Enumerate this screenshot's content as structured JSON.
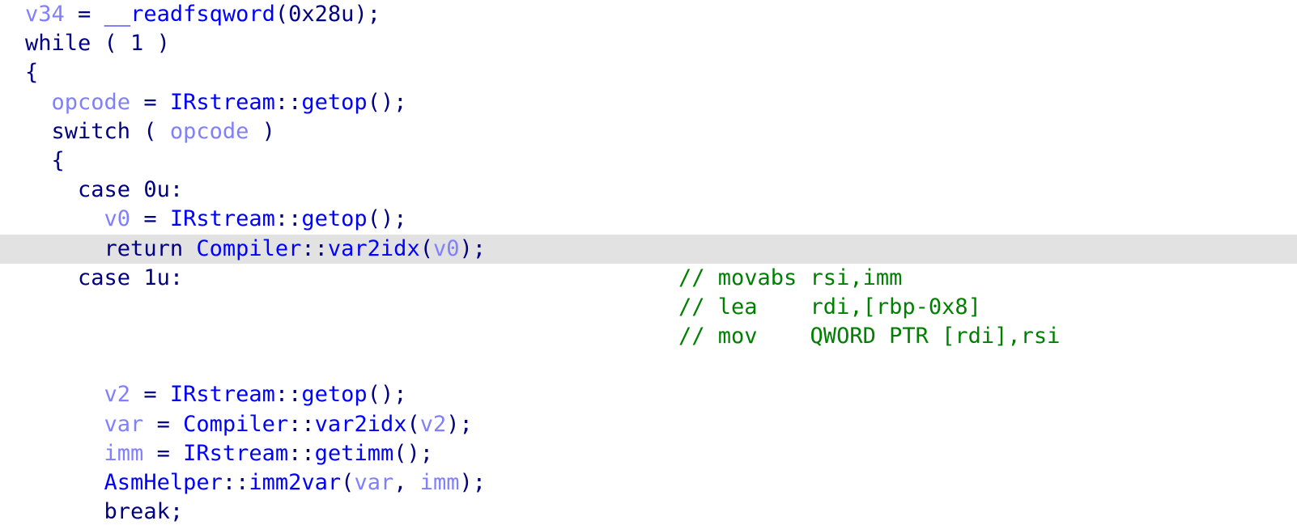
{
  "view": {
    "title": "Decompiler Pseudocode View",
    "background_color": "#ffffff",
    "highlight_color": "#e2e2e2",
    "font": "monospace",
    "colors": {
      "keyword": "#000080",
      "punctuation": "#000080",
      "number": "#000080",
      "variable": "#8080ff",
      "function": "#0000ff",
      "class": "#0000ff",
      "comment": "#008000"
    }
  },
  "lines": [
    {
      "index": 0,
      "highlighted": false,
      "text": "v34 = __readfsqword(0x28u);",
      "indent": 0,
      "tokens": [
        {
          "text": "v34",
          "kind": "var"
        },
        {
          "text": " = ",
          "kind": "punct"
        },
        {
          "text": "__readfsqword",
          "kind": "func"
        },
        {
          "text": "(",
          "kind": "punct"
        },
        {
          "text": "0x28u",
          "kind": "num"
        },
        {
          "text": ");",
          "kind": "punct"
        }
      ],
      "comment": ""
    },
    {
      "index": 1,
      "highlighted": false,
      "text": "while ( 1 )",
      "indent": 0,
      "tokens": [
        {
          "text": "while ( ",
          "kind": "kw"
        },
        {
          "text": "1",
          "kind": "num"
        },
        {
          "text": " )",
          "kind": "punct"
        }
      ],
      "comment": ""
    },
    {
      "index": 2,
      "highlighted": false,
      "text": "{",
      "indent": 0,
      "tokens": [
        {
          "text": "{",
          "kind": "punct"
        }
      ],
      "comment": ""
    },
    {
      "index": 3,
      "highlighted": false,
      "text": "  opcode = IRstream::getop();",
      "indent": 1,
      "tokens": [
        {
          "text": "  ",
          "kind": "plain"
        },
        {
          "text": "opcode",
          "kind": "var"
        },
        {
          "text": " = ",
          "kind": "punct"
        },
        {
          "text": "IRstream",
          "kind": "class"
        },
        {
          "text": "::",
          "kind": "punct"
        },
        {
          "text": "getop",
          "kind": "func"
        },
        {
          "text": "();",
          "kind": "punct"
        }
      ],
      "comment": ""
    },
    {
      "index": 4,
      "highlighted": false,
      "text": "  switch ( opcode )",
      "indent": 1,
      "tokens": [
        {
          "text": "  ",
          "kind": "plain"
        },
        {
          "text": "switch ( ",
          "kind": "kw"
        },
        {
          "text": "opcode",
          "kind": "var"
        },
        {
          "text": " )",
          "kind": "punct"
        }
      ],
      "comment": ""
    },
    {
      "index": 5,
      "highlighted": false,
      "text": "  {",
      "indent": 1,
      "tokens": [
        {
          "text": "  {",
          "kind": "punct"
        }
      ],
      "comment": ""
    },
    {
      "index": 6,
      "highlighted": false,
      "text": "    case 0u:",
      "indent": 2,
      "tokens": [
        {
          "text": "    ",
          "kind": "plain"
        },
        {
          "text": "case ",
          "kind": "kw"
        },
        {
          "text": "0u",
          "kind": "num"
        },
        {
          "text": ":",
          "kind": "punct"
        }
      ],
      "comment": ""
    },
    {
      "index": 7,
      "highlighted": false,
      "text": "      v0 = IRstream::getop();",
      "indent": 3,
      "tokens": [
        {
          "text": "      ",
          "kind": "plain"
        },
        {
          "text": "v0",
          "kind": "var"
        },
        {
          "text": " = ",
          "kind": "punct"
        },
        {
          "text": "IRstream",
          "kind": "class"
        },
        {
          "text": "::",
          "kind": "punct"
        },
        {
          "text": "getop",
          "kind": "func"
        },
        {
          "text": "();",
          "kind": "punct"
        }
      ],
      "comment": ""
    },
    {
      "index": 8,
      "highlighted": true,
      "text": "      return Compiler::var2idx(v0);",
      "indent": 3,
      "tokens": [
        {
          "text": "      ",
          "kind": "plain"
        },
        {
          "text": "return ",
          "kind": "kw"
        },
        {
          "text": "Compiler",
          "kind": "class"
        },
        {
          "text": "::",
          "kind": "punct"
        },
        {
          "text": "var2idx",
          "kind": "func"
        },
        {
          "text": "(",
          "kind": "punct"
        },
        {
          "text": "v0",
          "kind": "var"
        },
        {
          "text": ");",
          "kind": "punct"
        }
      ],
      "comment": ""
    },
    {
      "index": 9,
      "highlighted": false,
      "text": "    case 1u:",
      "indent": 2,
      "tokens": [
        {
          "text": "    ",
          "kind": "plain"
        },
        {
          "text": "case ",
          "kind": "kw"
        },
        {
          "text": "1u",
          "kind": "num"
        },
        {
          "text": ":",
          "kind": "punct"
        }
      ],
      "comment": "// movabs rsi,imm"
    },
    {
      "index": 10,
      "highlighted": false,
      "text": "",
      "indent": 0,
      "tokens": [],
      "comment": "// lea    rdi,[rbp-0x8]"
    },
    {
      "index": 11,
      "highlighted": false,
      "text": "",
      "indent": 0,
      "tokens": [],
      "comment": "// mov    QWORD PTR [rdi],rsi"
    },
    {
      "index": 12,
      "highlighted": false,
      "text": "",
      "indent": 0,
      "tokens": [],
      "comment": ""
    },
    {
      "index": 13,
      "highlighted": false,
      "text": "      v2 = IRstream::getop();",
      "indent": 3,
      "tokens": [
        {
          "text": "      ",
          "kind": "plain"
        },
        {
          "text": "v2",
          "kind": "var"
        },
        {
          "text": " = ",
          "kind": "punct"
        },
        {
          "text": "IRstream",
          "kind": "class"
        },
        {
          "text": "::",
          "kind": "punct"
        },
        {
          "text": "getop",
          "kind": "func"
        },
        {
          "text": "();",
          "kind": "punct"
        }
      ],
      "comment": ""
    },
    {
      "index": 14,
      "highlighted": false,
      "text": "      var = Compiler::var2idx(v2);",
      "indent": 3,
      "tokens": [
        {
          "text": "      ",
          "kind": "plain"
        },
        {
          "text": "var",
          "kind": "var"
        },
        {
          "text": " = ",
          "kind": "punct"
        },
        {
          "text": "Compiler",
          "kind": "class"
        },
        {
          "text": "::",
          "kind": "punct"
        },
        {
          "text": "var2idx",
          "kind": "func"
        },
        {
          "text": "(",
          "kind": "punct"
        },
        {
          "text": "v2",
          "kind": "var"
        },
        {
          "text": ");",
          "kind": "punct"
        }
      ],
      "comment": ""
    },
    {
      "index": 15,
      "highlighted": false,
      "text": "      imm = IRstream::getimm();",
      "indent": 3,
      "tokens": [
        {
          "text": "      ",
          "kind": "plain"
        },
        {
          "text": "imm",
          "kind": "var"
        },
        {
          "text": " = ",
          "kind": "punct"
        },
        {
          "text": "IRstream",
          "kind": "class"
        },
        {
          "text": "::",
          "kind": "punct"
        },
        {
          "text": "getimm",
          "kind": "func"
        },
        {
          "text": "();",
          "kind": "punct"
        }
      ],
      "comment": ""
    },
    {
      "index": 16,
      "highlighted": false,
      "text": "      AsmHelper::imm2var(var, imm);",
      "indent": 3,
      "tokens": [
        {
          "text": "      ",
          "kind": "plain"
        },
        {
          "text": "AsmHelper",
          "kind": "class"
        },
        {
          "text": "::",
          "kind": "punct"
        },
        {
          "text": "imm2var",
          "kind": "func"
        },
        {
          "text": "(",
          "kind": "punct"
        },
        {
          "text": "var",
          "kind": "var"
        },
        {
          "text": ", ",
          "kind": "punct"
        },
        {
          "text": "imm",
          "kind": "var"
        },
        {
          "text": ");",
          "kind": "punct"
        }
      ],
      "comment": ""
    },
    {
      "index": 17,
      "highlighted": false,
      "text": "      break;",
      "indent": 3,
      "tokens": [
        {
          "text": "      ",
          "kind": "plain"
        },
        {
          "text": "break",
          "kind": "kw"
        },
        {
          "text": ";",
          "kind": "punct"
        }
      ],
      "comment": ""
    }
  ]
}
